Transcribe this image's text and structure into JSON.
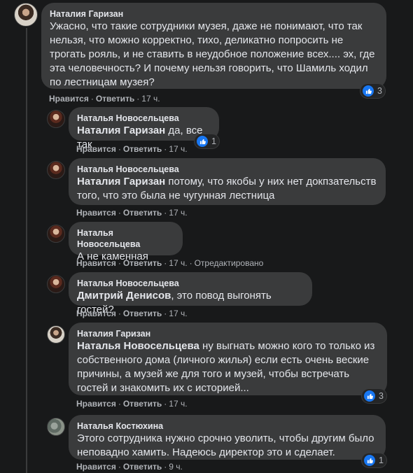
{
  "actions": {
    "like": "Нравится",
    "reply": "Ответить",
    "separator": "·"
  },
  "root": {
    "author": "Наталия Гаризан",
    "text": "Ужасно, что такие сотрудники музея, даже не понимают, что так нельзя, что можно корректно, тихо, деликатно попросить не трогать рояль, и не ставить в неудобное положение всех.... эх, где эта человечность? И почему нельзя говорить, что Шамиль ходил по лестницам музея?",
    "time": "17 ч.",
    "reactions": "3"
  },
  "replies": [
    {
      "author": "Наталья Новосельцева",
      "mention": "Наталия Гаризан",
      "text": " да, все так",
      "time": "17 ч.",
      "reactions": "1"
    },
    {
      "author": "Наталья Новосельцева",
      "mention": "Наталия Гаризан",
      "text": " потому, что якобы у них нет докпзательств того, что это была не чугунная лестница",
      "time": "17 ч."
    },
    {
      "author": "Наталья Новосельцева",
      "mention": "",
      "text": "А не каменная",
      "time": "17 ч.",
      "edited": "Отредактировано"
    },
    {
      "author": "Наталья Новосельцева",
      "mention": "Дмитрий Денисов",
      "text": ", это повод выгонять гостей?",
      "time": "17 ч."
    },
    {
      "author": "Наталия Гаризан",
      "mention": "Наталья Новосельцева",
      "text": " ну выгнать можно кого то только из собственного дома (личного жилья) если есть очень веские причины, а музей же для того и музей, чтобы встречать гостей и знакомить их с историей...",
      "time": "17 ч.",
      "reactions": "3"
    },
    {
      "author": "Наталья Костюхина",
      "mention": "",
      "text": "Этого сотрудника нужно срочно уволить, чтобы другим было неповадно хамить. Надеюсь директор это и сделает.",
      "time": "9 ч.",
      "reactions": "1"
    }
  ]
}
